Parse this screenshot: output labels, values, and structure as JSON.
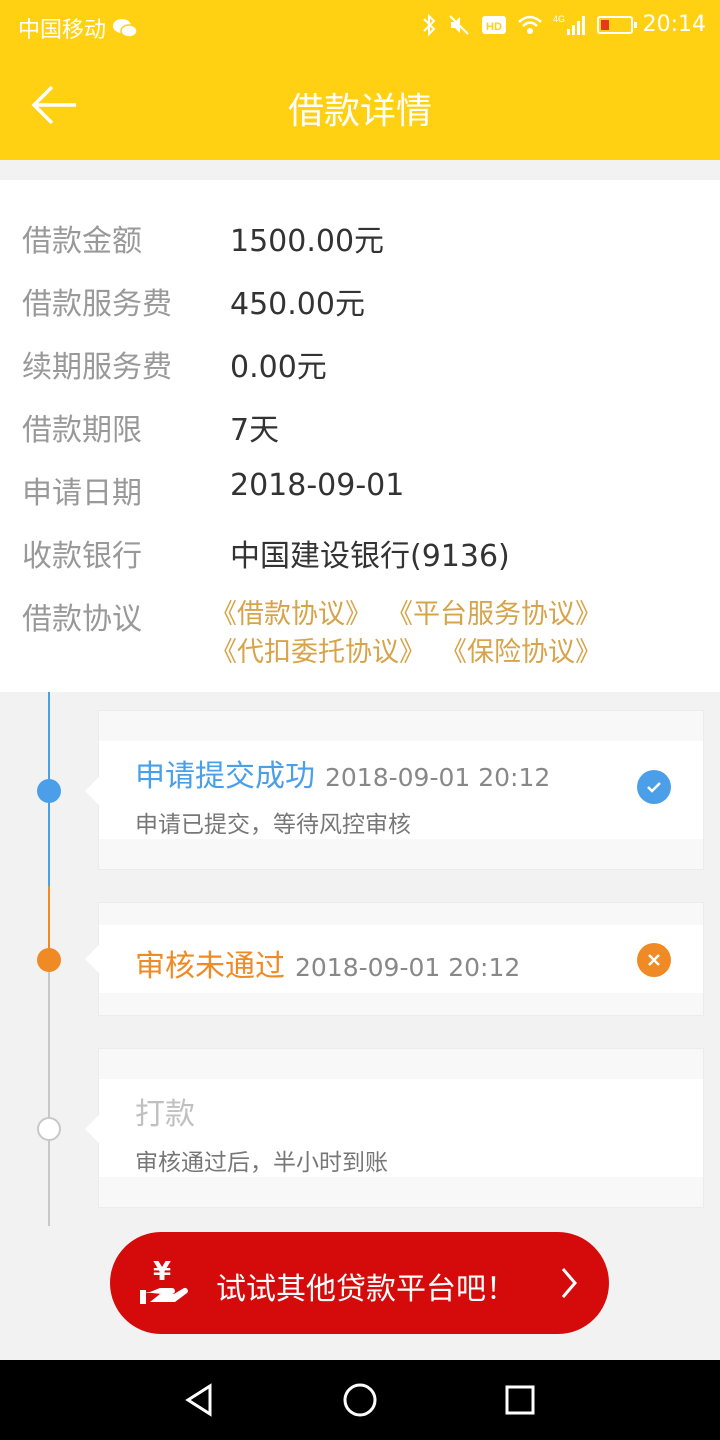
{
  "status_bar": {
    "carrier": "中国移动",
    "time": "20:14",
    "network": "4G",
    "icons": [
      "wechat-icon",
      "bluetooth-icon",
      "mute-icon",
      "hd-icon",
      "wifi-icon",
      "signal-icon",
      "battery-icon"
    ]
  },
  "header": {
    "title": "借款详情",
    "back_icon": "back-arrow-icon",
    "background_color": "#ffd112"
  },
  "details": [
    {
      "label": "借款金额",
      "value": "1500.00元"
    },
    {
      "label": "借款服务费",
      "value": "450.00元"
    },
    {
      "label": "续期服务费",
      "value": "0.00元"
    },
    {
      "label": "借款期限",
      "value": "7天"
    },
    {
      "label": "申请日期",
      "value": "2018-09-01"
    },
    {
      "label": "收款银行",
      "value": "中国建设银行(9136)"
    }
  ],
  "agreement": {
    "label": "借款协议",
    "links": [
      "《借款协议》",
      "《平台服务协议》",
      "《代扣委托协议》",
      "《保险协议》"
    ]
  },
  "timeline": [
    {
      "title": "申请提交成功",
      "time": "2018-09-01 20:12",
      "desc": "申请已提交，等待风控审核",
      "status": "success",
      "color": "#4a9fe8",
      "icon": "check-icon"
    },
    {
      "title": "审核未通过",
      "time": "2018-09-01 20:12",
      "desc": "",
      "status": "failed",
      "color": "#f08a24",
      "icon": "close-icon"
    },
    {
      "title": "打款",
      "time": "",
      "desc": "审核通过后，半小时到账",
      "status": "pending",
      "color": "#c8c8c8",
      "icon": ""
    }
  ],
  "cta": {
    "label": "试试其他贷款平台吧！",
    "icon": "loan-hand-icon",
    "color": "#d50b0b"
  },
  "nav": {
    "icons": [
      "back-triangle-icon",
      "home-circle-icon",
      "recent-square-icon"
    ]
  }
}
